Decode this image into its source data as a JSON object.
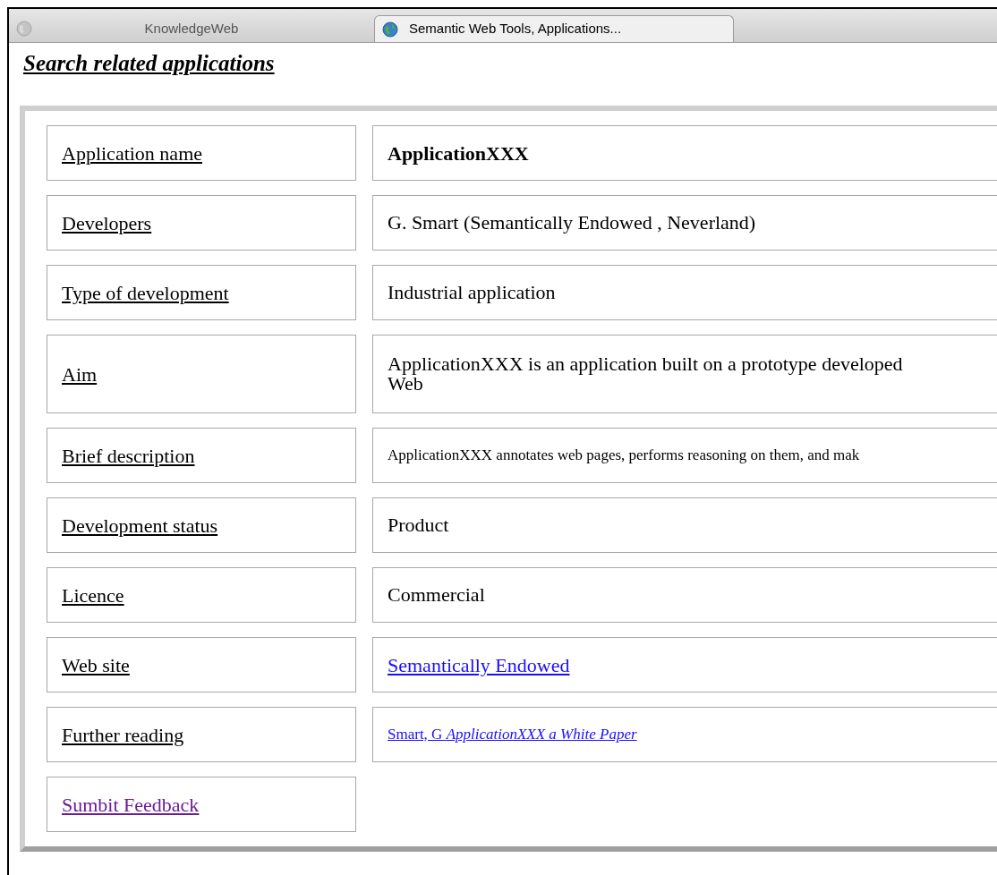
{
  "tabs": [
    {
      "label": "KnowledgeWeb",
      "selected": false
    },
    {
      "label": "Semantic Web Tools, Applications...",
      "selected": true
    }
  ],
  "heading": "Search related applications",
  "rows": [
    {
      "label": "Application name",
      "value": "ApplicationXXX",
      "kind": "bold"
    },
    {
      "label": "Developers",
      "value": "G. Smart (Semantically Endowed , Neverland)",
      "kind": "plain"
    },
    {
      "label": "Type of development",
      "value": "Industrial application",
      "kind": "plain"
    },
    {
      "label": "Aim",
      "value": "ApplicationXXX is an application built on a prototype developed\nWeb",
      "kind": "plain"
    },
    {
      "label": "Brief description",
      "value": "ApplicationXXX annotates web pages, performs reasoning on them, and mak",
      "kind": "small"
    },
    {
      "label": "Development status",
      "value": "Product",
      "kind": "plain"
    },
    {
      "label": "Licence",
      "value": "Commercial",
      "kind": "plain"
    },
    {
      "label": "Web site",
      "value": "Semantically Endowed",
      "kind": "link"
    },
    {
      "label": "Further reading",
      "value": "Smart, G *ApplicationXXX a White Paper*",
      "kind": "small_link"
    }
  ],
  "feedback_link": "Sumbit Feedback"
}
